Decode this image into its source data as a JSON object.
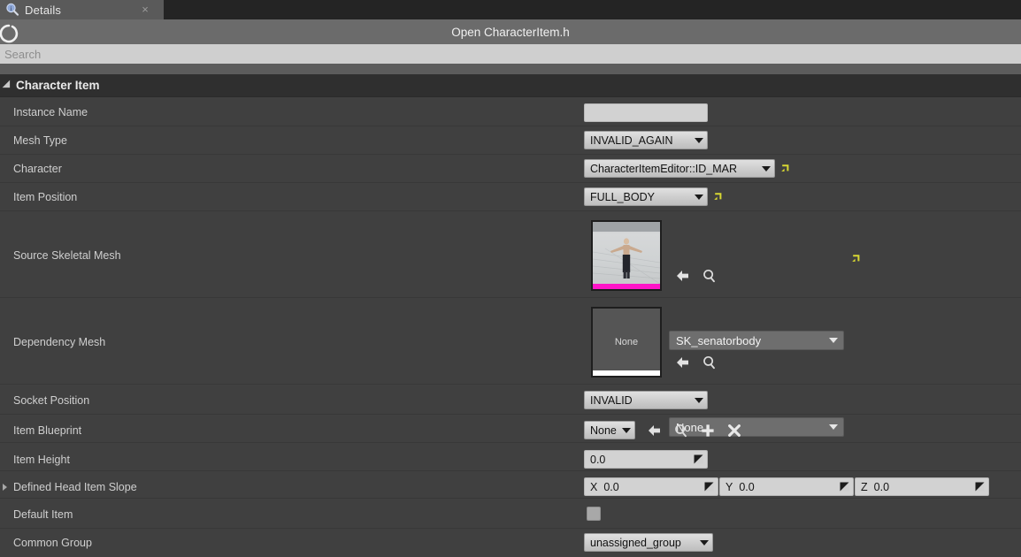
{
  "tab": {
    "label": "Details",
    "icon": "details-magnifier-icon",
    "close_label": "×"
  },
  "toolbar": {
    "title": "Open CharacterItem.h",
    "icon": "circle-outline-icon"
  },
  "search": {
    "placeholder": "Search",
    "value": ""
  },
  "category": {
    "title": "Character Item",
    "expanded": true
  },
  "colors": {
    "panel_bg": "#404040",
    "header_bg": "#2f2f2f",
    "toolbar_bg": "#6b6b6b",
    "search_bg": "#cfcfcf",
    "tab_bg": "#5a5a5a",
    "reset_yellow": "#d8d832",
    "thumb_accent_magenta": "#ff14c8",
    "thumb_accent_white": "#ffffff"
  },
  "properties": [
    {
      "name": "instance-name",
      "label": "Instance Name",
      "type": "text",
      "value": "",
      "placeholder": ""
    },
    {
      "name": "mesh-type",
      "label": "Mesh Type",
      "type": "combo",
      "value": "INVALID_AGAIN",
      "has_reset": false
    },
    {
      "name": "character",
      "label": "Character",
      "type": "combo",
      "value": "CharacterItemEditor::ID_MAR",
      "has_reset": true
    },
    {
      "name": "item-position",
      "label": "Item Position",
      "type": "combo",
      "value": "FULL_BODY",
      "has_reset": true
    },
    {
      "name": "source-skeletal-mesh",
      "label": "Source Skeletal Mesh",
      "type": "asset",
      "value": "SK_senatorbody",
      "thumbnail": "character-t-pose-thumbnail",
      "thumbnail_accent": "#ff14c8",
      "thumbnail_caption": "",
      "has_reset": true,
      "buttons": [
        "browse-back-icon",
        "find-in-content-browser-icon"
      ]
    },
    {
      "name": "dependency-mesh",
      "label": "Dependency Mesh",
      "type": "asset",
      "value": "None",
      "thumbnail": "none-thumbnail",
      "thumbnail_accent": "#ffffff",
      "thumbnail_caption": "None",
      "has_reset": false,
      "buttons": [
        "browse-back-icon",
        "find-in-content-browser-icon"
      ]
    },
    {
      "name": "socket-position",
      "label": "Socket Position",
      "type": "combo",
      "value": "INVALID",
      "has_reset": false
    },
    {
      "name": "item-blueprint",
      "label": "Item Blueprint",
      "type": "object",
      "value": "None",
      "buttons": [
        "browse-back-icon",
        "find-in-content-browser-icon",
        "add-icon",
        "clear-icon"
      ]
    },
    {
      "name": "item-height",
      "label": "Item Height",
      "type": "number",
      "value": "0.0"
    },
    {
      "name": "defined-head-item-slope",
      "label": "Defined Head Item Slope",
      "type": "vector3",
      "expandable": true,
      "axes": [
        {
          "axis": "X",
          "value": "0.0"
        },
        {
          "axis": "Y",
          "value": "0.0"
        },
        {
          "axis": "Z",
          "value": "0.0"
        }
      ]
    },
    {
      "name": "default-item",
      "label": "Default Item",
      "type": "checkbox",
      "checked": false
    },
    {
      "name": "common-group",
      "label": "Common Group",
      "type": "combo",
      "value": "unassigned_group",
      "has_reset": false
    }
  ]
}
